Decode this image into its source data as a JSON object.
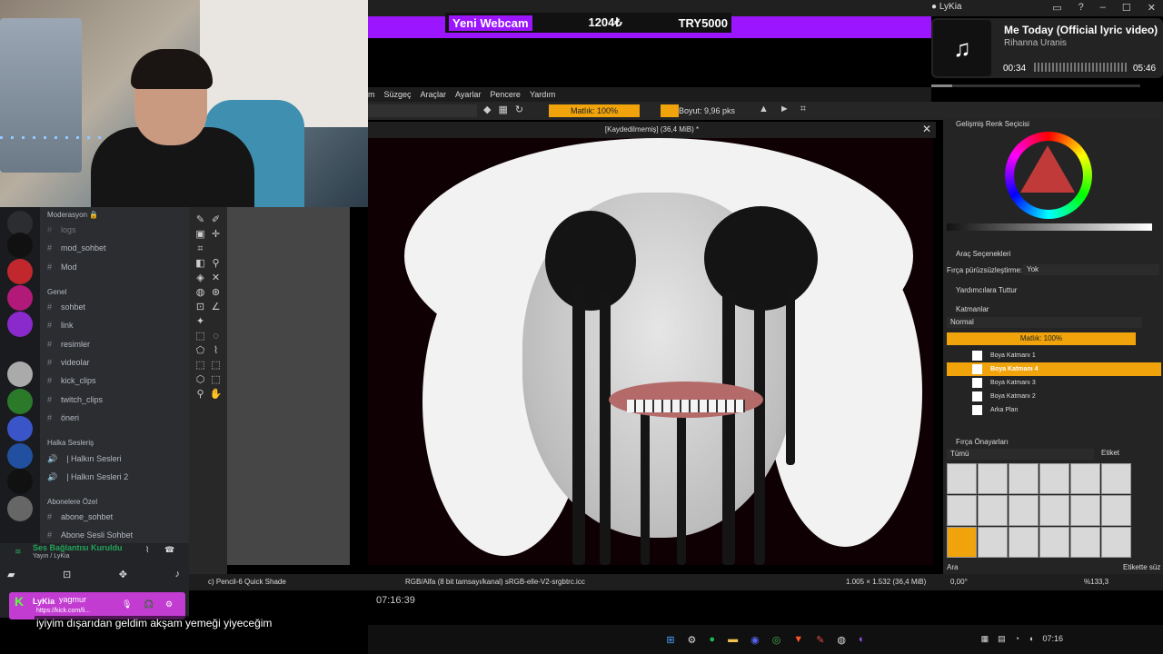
{
  "stream": {
    "streamer": "LyKia",
    "alert": {
      "label": "Yeni Webcam",
      "amount": "1204₺",
      "goal": "TRY5000"
    }
  },
  "music": {
    "song": "Me Today (Official lyric video)",
    "artist": "Rihanna Uranis",
    "elapsed": "00:34",
    "duration": "05:46",
    "progress": 0.1
  },
  "krita": {
    "menu": [
      "m",
      "Süzgeç",
      "Araçlar",
      "Ayarlar",
      "Pencere",
      "Yardım"
    ],
    "toolbar": {
      "opacity": "Matlık: 100%",
      "size": "Boyut: 9,96 pks"
    },
    "doc_title": "[Kaydedilmemiş]  (36,4 MiB) *",
    "dockers": {
      "color": "Gelişmiş Renk Seçicisi",
      "tool_options": "Araç Seçenekleri",
      "smoothing_label": "Fırça pürüzsüzleştirme:",
      "smoothing_value": "Yok",
      "snap": "Yardımcılara Tuttur",
      "layers": "Katmanlar",
      "blend_mode": "Normal",
      "layer_opacity": "Matlık:  100%",
      "layer_list": [
        "Boya Katmanı 1",
        "Boya Katmanı 4",
        "Boya Katmanı 3",
        "Boya Katmanı 2",
        "Arka Plan"
      ],
      "brush_presets": "Fırça Önayarları",
      "all": "Tümü",
      "tag": "Etiket",
      "search": "Ara",
      "tag_filter": "Etikette süz"
    },
    "status": {
      "brush": "c) Pencil-6 Quick Shade",
      "color_space": "RGB/Alfa (8 bit tamsayı/kanal)  sRGB-elle-V2-srgbtrc.icc",
      "dims": "1.005 × 1.532 (36,4 MiB)",
      "angle": "0,00°",
      "zoom": "%133,3"
    }
  },
  "discord": {
    "categories": [
      {
        "name": "Moderasyon 🔒",
        "channels": [
          "logs",
          "mod_sohbet",
          "Mod"
        ]
      },
      {
        "name": "Genel",
        "channels": [
          "sohbet",
          "link",
          "resimler",
          "videolar",
          "kick_clips",
          "twitch_clips",
          "öneri"
        ]
      },
      {
        "name": "Halka Sesleriş",
        "channels": [
          "| Halkın Sesleri",
          "| Halkın Sesleri 2"
        ]
      },
      {
        "name": "Abonelere Özel",
        "channels": [
          "abone_sohbet",
          "Abone Sesli Sohbet"
        ]
      }
    ],
    "voice": {
      "status": "Ses Bağlantısı Kuruldu",
      "channel": "Yayın / LyKia"
    },
    "user": {
      "name": "LyKia",
      "display": "yagmur",
      "status": "https://kick.com/li..."
    }
  },
  "clock": "07:16:39",
  "subtitle": "iyiyim dışarıdan geldim akşam yemeği yiyeceğim",
  "taskbar": {
    "time": "07:16"
  }
}
